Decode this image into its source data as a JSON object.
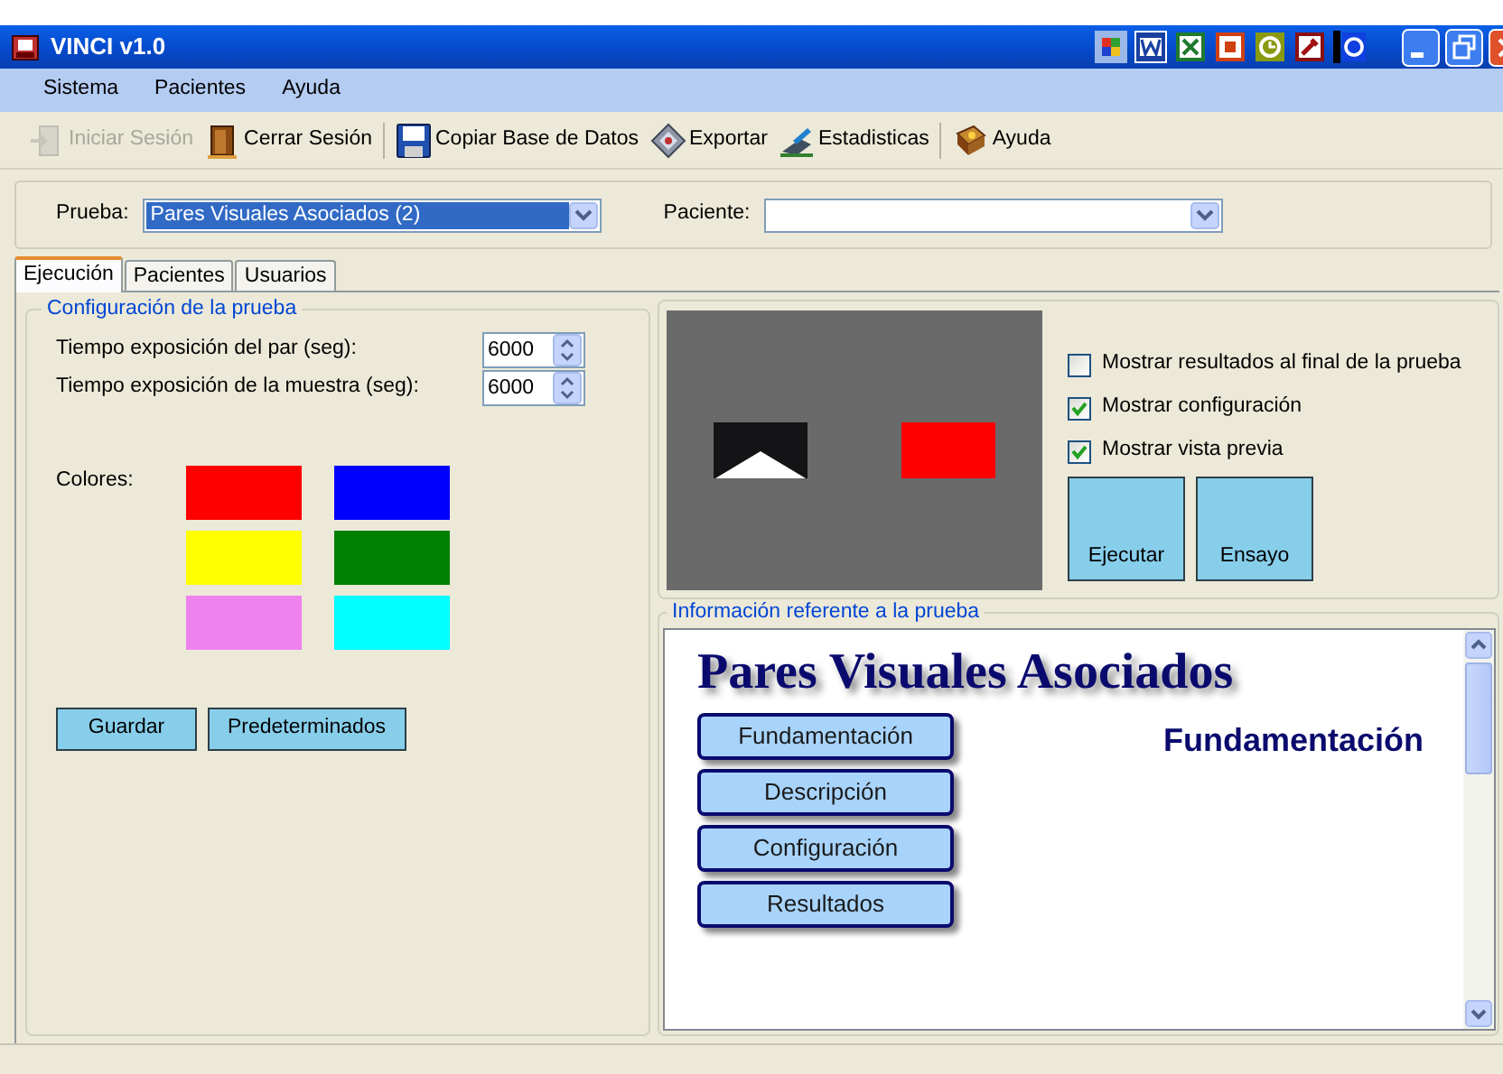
{
  "window": {
    "title": "VINCI v1.0"
  },
  "menu": [
    "Sistema",
    "Pacientes",
    "Ayuda"
  ],
  "toolbar_groups": [
    {
      "items": [
        {
          "label": "Iniciar Sesión",
          "disabled": true
        },
        {
          "label": "Cerrar Sesión",
          "disabled": false
        }
      ]
    },
    {
      "items": [
        {
          "label": "Copiar Base de Datos",
          "disabled": false
        },
        {
          "label": "Exportar",
          "disabled": false
        },
        {
          "label": "Estadisticas",
          "disabled": false
        }
      ]
    },
    {
      "items": [
        {
          "label": "Ayuda",
          "disabled": false
        }
      ]
    }
  ],
  "selectors": [
    {
      "label": "Prueba:",
      "value": "Pares Visuales Asociados (2)",
      "highlighted": true
    },
    {
      "label": "Paciente:"
    }
  ],
  "tabs": [
    {
      "label": "Ejecución",
      "selected": true
    },
    {
      "label": "Pacientes",
      "selected": false
    },
    {
      "label": "Usuarios",
      "selected": false
    }
  ],
  "config": {
    "title": "Configuración de la prueba",
    "spinners": [
      {
        "label": "Tiempo exposición del par (seg):",
        "value": "6000"
      },
      {
        "label": "Tiempo exposición de la muestra (seg):",
        "value": "6000"
      }
    ],
    "colors_label": "Colores:",
    "colors": [
      {
        "color": "#ff0000"
      },
      {
        "color": "#0000ff"
      },
      {
        "color": "#ffff00"
      },
      {
        "color": "#008000"
      },
      {
        "color": "#ee82ee"
      },
      {
        "color": "#00ffff"
      }
    ],
    "buttons": [
      "Guardar",
      "Predeterminados"
    ]
  },
  "options": [
    {
      "label": "Mostrar resultados al final de la prueba",
      "checked": false
    },
    {
      "label": "Mostrar configuración",
      "checked": true
    },
    {
      "label": "Mostrar vista previa",
      "checked": true
    }
  ],
  "actions": [
    "Ejecutar",
    "Ensayo"
  ],
  "info": {
    "title": "Información referente a la prueba",
    "heading": "Pares Visuales Asociados",
    "nav": [
      "Fundamentación",
      "Descripción",
      "Configuración",
      "Resultados"
    ],
    "section_title": "Fundamentación"
  }
}
